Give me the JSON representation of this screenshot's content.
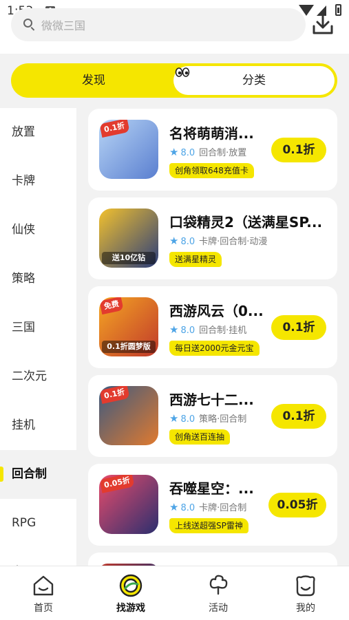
{
  "status_bar": {
    "time": "1:53",
    "sim_label": "A"
  },
  "search": {
    "placeholder": "微微三国"
  },
  "tabs": [
    {
      "label": "发现",
      "active": false
    },
    {
      "label": "分类",
      "active": true
    }
  ],
  "sidebar": {
    "items": [
      {
        "label": "放置"
      },
      {
        "label": "卡牌"
      },
      {
        "label": "仙侠"
      },
      {
        "label": "策略"
      },
      {
        "label": "三国"
      },
      {
        "label": "二次元"
      },
      {
        "label": "挂机"
      },
      {
        "label": "回合制",
        "active": true
      },
      {
        "label": "RPG"
      },
      {
        "label": "宫..."
      }
    ]
  },
  "games": [
    {
      "title": "名将萌萌消...",
      "rating": "8.0",
      "tags": "回合制·放置",
      "promo": "创角领取648充值卡",
      "discount": "0.1折",
      "thumb_tag": "0.1折",
      "thumb_banner": "",
      "thumb_colors": [
        "#b7d4f5",
        "#5a7fd0"
      ]
    },
    {
      "title": "口袋精灵2（送满星SP...",
      "rating": "8.0",
      "tags": "卡牌·回合制·动漫",
      "promo": "送满星精灵",
      "discount": "",
      "thumb_tag": "",
      "thumb_banner": "送10亿钻",
      "thumb_colors": [
        "#f2c12e",
        "#2c3e7a"
      ]
    },
    {
      "title": "西游风云（0...",
      "rating": "8.0",
      "tags": "回合制·挂机",
      "promo": "每日送2000元金元宝",
      "discount": "0.1折",
      "thumb_tag": "免费",
      "thumb_banner": "0.1折圆梦版",
      "thumb_colors": [
        "#f5a623",
        "#c0392b"
      ]
    },
    {
      "title": "西游七十二...",
      "rating": "8.0",
      "tags": "策略·回合制",
      "promo": "创角送百连抽",
      "discount": "0.1折",
      "thumb_tag": "0.1折",
      "thumb_banner": "",
      "thumb_colors": [
        "#3d5a80",
        "#e07a2f"
      ]
    },
    {
      "title": "吞噬星空：...",
      "rating": "8.0",
      "tags": "卡牌·回合制",
      "promo": "上线送超强SP雷神",
      "discount": "0.05折",
      "thumb_tag": "0.05折",
      "thumb_banner": "",
      "thumb_colors": [
        "#e74c6c",
        "#2c2f6e"
      ]
    }
  ],
  "bottom_nav": [
    {
      "label": "首页",
      "icon": "home-icon"
    },
    {
      "label": "找游戏",
      "icon": "find-game-icon",
      "active": true
    },
    {
      "label": "活动",
      "icon": "activity-icon"
    },
    {
      "label": "我的",
      "icon": "profile-icon"
    }
  ],
  "colors": {
    "accent": "#f5e600",
    "rating": "#4da4e6",
    "background": "#f2f2f2"
  }
}
